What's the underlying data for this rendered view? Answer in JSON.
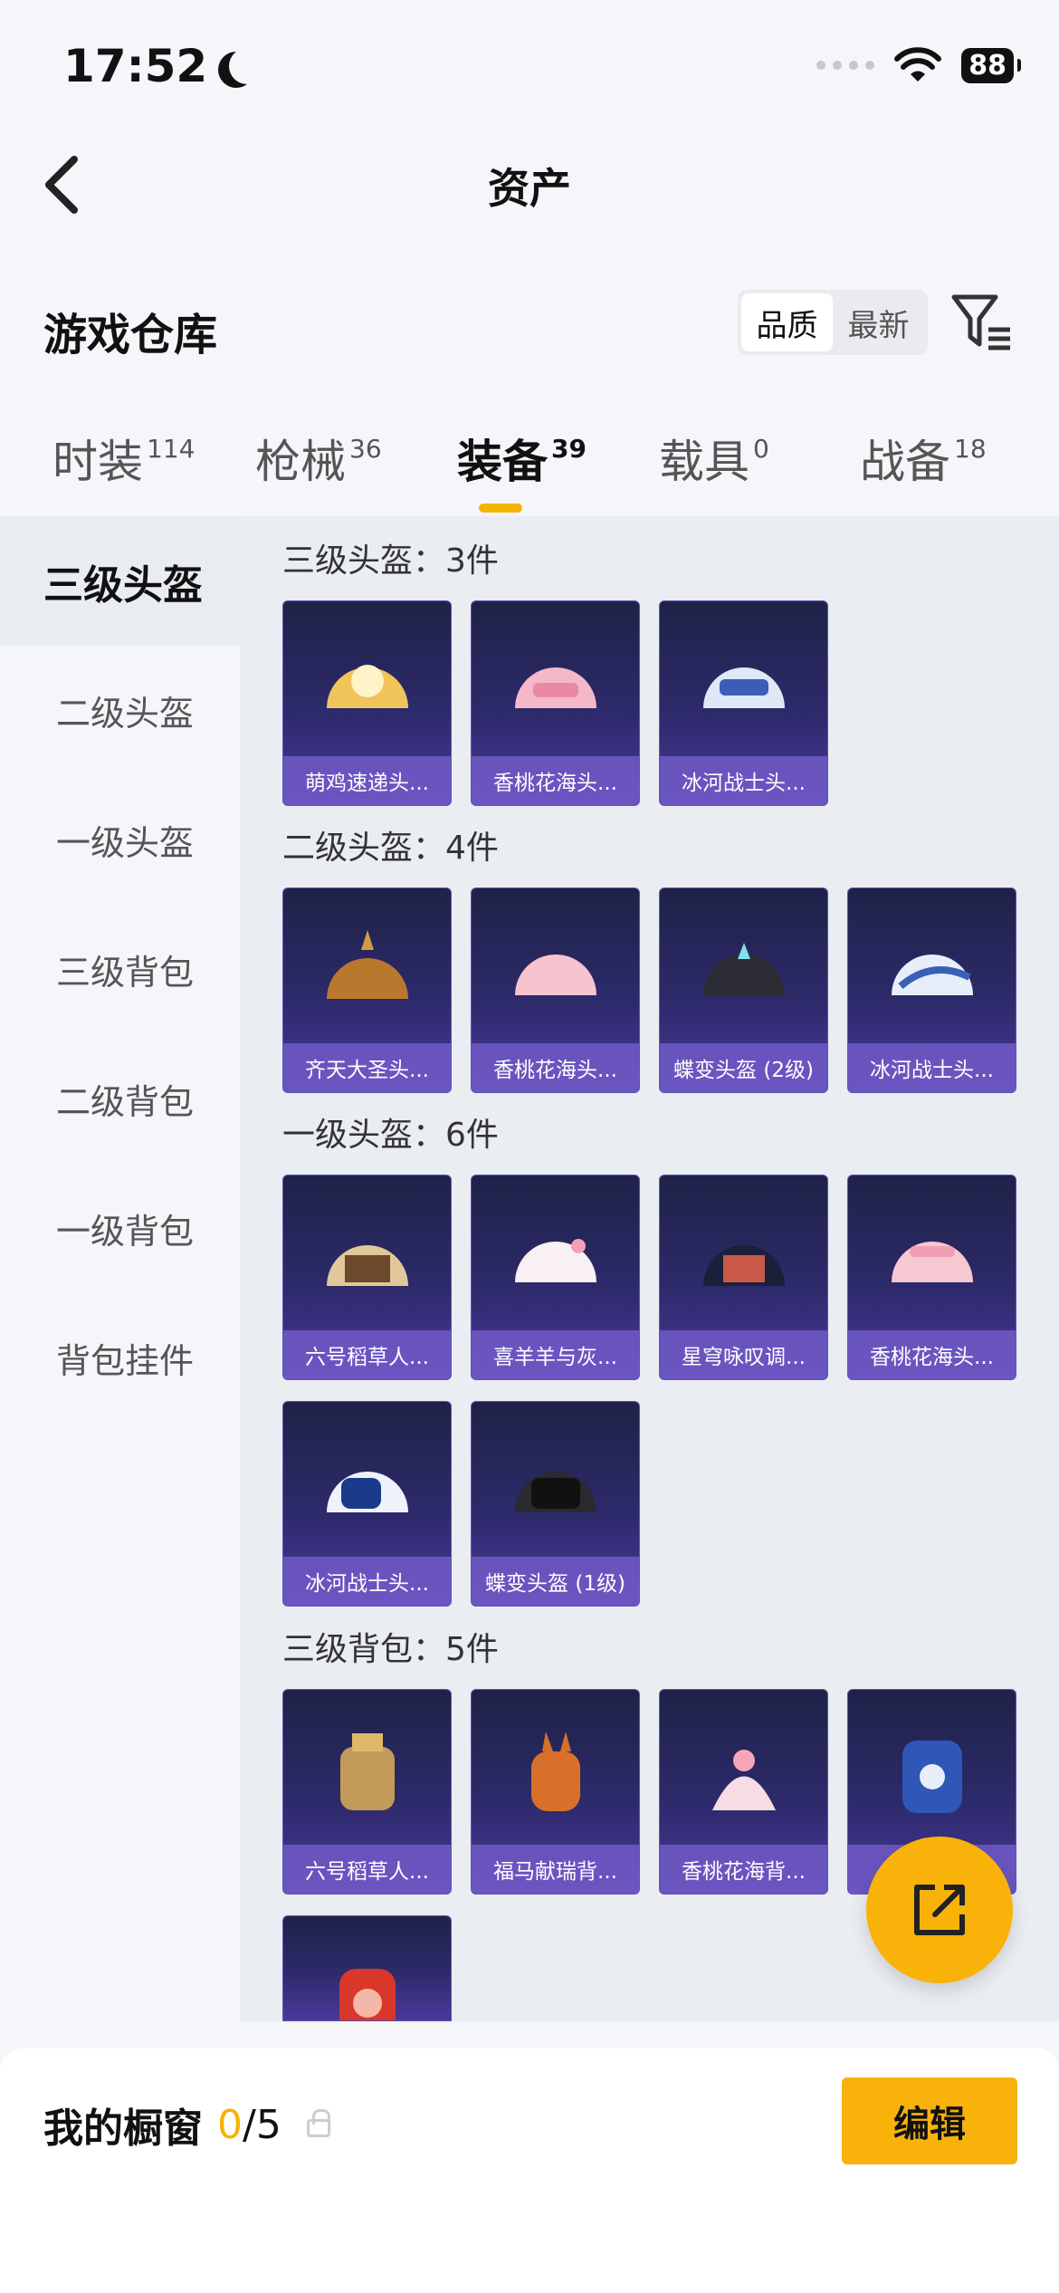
{
  "status": {
    "time": "17:52",
    "battery": "88"
  },
  "nav": {
    "title": "资产"
  },
  "warehouse": {
    "label": "游戏仓库",
    "sort_options": [
      "品质",
      "最新"
    ],
    "sort_active": "品质"
  },
  "tabs": [
    {
      "label": "时装",
      "count": "114"
    },
    {
      "label": "枪械",
      "count": "36"
    },
    {
      "label": "装备",
      "count": "39",
      "active": true
    },
    {
      "label": "载具",
      "count": "0"
    },
    {
      "label": "战备",
      "count": "18"
    }
  ],
  "sidebar": {
    "items": [
      {
        "label": "三级头盔",
        "active": true
      },
      {
        "label": "二级头盔"
      },
      {
        "label": "一级头盔"
      },
      {
        "label": "三级背包"
      },
      {
        "label": "二级背包"
      },
      {
        "label": "一级背包"
      },
      {
        "label": "背包挂件"
      }
    ]
  },
  "sections": [
    {
      "title": "三级头盔：3件",
      "items": [
        "萌鸡速递头...",
        "香桃花海头...",
        "冰河战士头..."
      ]
    },
    {
      "title": "二级头盔：4件",
      "items": [
        "齐天大圣头...",
        "香桃花海头...",
        "蝶变头盔 (2级)",
        "冰河战士头..."
      ]
    },
    {
      "title": "一级头盔：6件",
      "items": [
        "六号稻草人...",
        "喜羊羊与灰...",
        "星穹咏叹调...",
        "香桃花海头...",
        "冰河战士头...",
        "蝶变头盔 (1级)"
      ]
    },
    {
      "title": "三级背包：5件",
      "items": [
        "六号稻草人...",
        "福马献瑞背...",
        "香桃花海背...",
        "冰..."
      ]
    }
  ],
  "bottom": {
    "label": "我的橱窗",
    "count": "0",
    "max": "/5",
    "edit_label": "编辑"
  },
  "colors": {
    "accent": "#f9b20a",
    "card_bg": "#2d2a6b"
  }
}
